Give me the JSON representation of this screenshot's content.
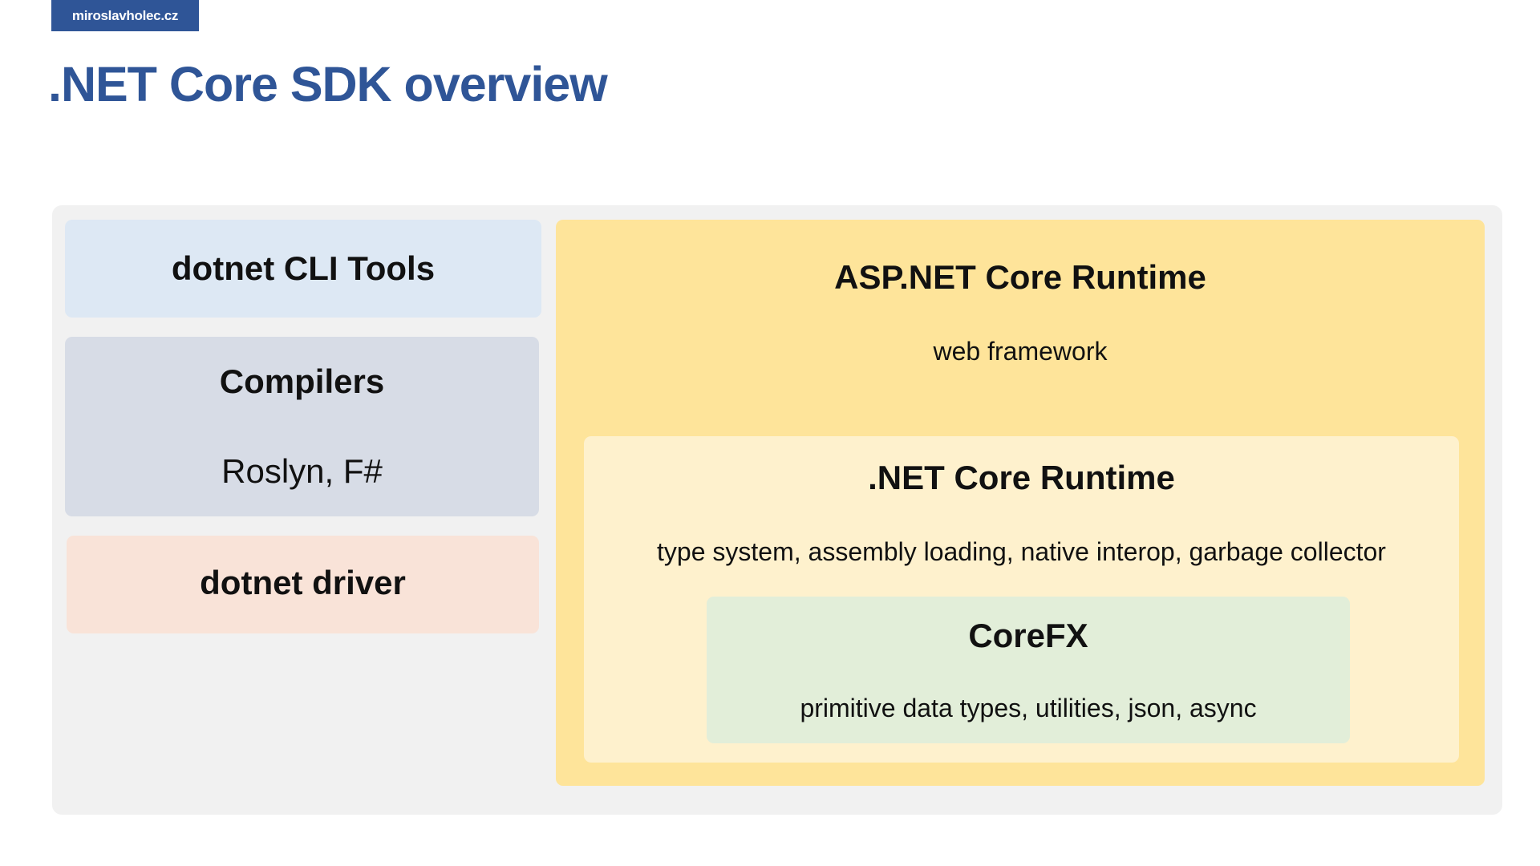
{
  "header": {
    "brand": "miroslavholec.cz",
    "title": ".NET Core SDK overview"
  },
  "left_column": {
    "cli_tools": {
      "title": "dotnet CLI Tools"
    },
    "compilers": {
      "title": "Compilers",
      "subtitle": "Roslyn, F#"
    },
    "driver": {
      "title": "dotnet driver"
    }
  },
  "right_column": {
    "aspnet_runtime": {
      "title": "ASP.NET Core Runtime",
      "subtitle": "web framework"
    },
    "netcore_runtime": {
      "title": ".NET Core Runtime",
      "subtitle": "type system, assembly loading, native interop, garbage collector"
    },
    "corefx": {
      "title": "CoreFX",
      "subtitle": "primitive data types, utilities, json, async"
    }
  },
  "colors": {
    "brand": "#2f5597",
    "panel": "#f1f1f1",
    "cli_tools": "#dde8f4",
    "compilers": "#d7dce6",
    "driver": "#f9e3d8",
    "aspnet_runtime": "#fee49a",
    "netcore_runtime": "#fef1cd",
    "corefx": "#e2eed9"
  }
}
